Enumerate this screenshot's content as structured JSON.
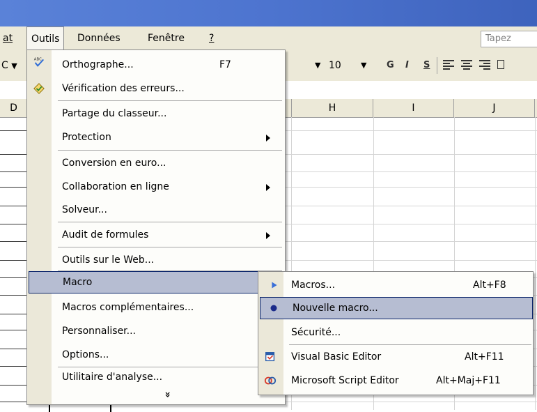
{
  "menubar": {
    "items": [
      "at",
      "Outils",
      "Données",
      "Fenêtre",
      "?"
    ],
    "ask_placeholder": "Tapez"
  },
  "toolbar": {
    "left_fragment": "C",
    "font_size": "10",
    "bold": "G",
    "italic": "I",
    "underline": "S"
  },
  "columns": [
    "D",
    "H",
    "I",
    "J"
  ],
  "tools_menu": {
    "items": [
      {
        "label": "Orthographe...",
        "shortcut": "F7",
        "icon": "spellcheck-icon"
      },
      {
        "label": "Vérification des erreurs...",
        "icon": "error-check-icon"
      },
      {
        "label": "Partage du classeur..."
      },
      {
        "label": "Protection",
        "submenu": true
      },
      {
        "label": "Conversion en euro..."
      },
      {
        "label": "Collaboration en ligne",
        "submenu": true
      },
      {
        "label": "Solveur..."
      },
      {
        "label": "Audit de formules",
        "submenu": true
      },
      {
        "label": "Outils sur le Web..."
      },
      {
        "label": "Macro",
        "submenu": true,
        "highlighted": true
      },
      {
        "label": "Macros complémentaires..."
      },
      {
        "label": "Personnaliser..."
      },
      {
        "label": "Options..."
      },
      {
        "label": "Utilitaire d'analyse..."
      }
    ],
    "expand_glyph": "»"
  },
  "macro_menu": {
    "items": [
      {
        "label": "Macros...",
        "shortcut": "Alt+F8",
        "icon": "run-macro-icon"
      },
      {
        "label": "Nouvelle macro...",
        "icon": "record-macro-icon",
        "highlighted": true
      },
      {
        "label": "Sécurité..."
      },
      {
        "label": "Visual Basic Editor",
        "shortcut": "Alt+F11",
        "icon": "vb-editor-icon"
      },
      {
        "label": "Microsoft Script Editor",
        "shortcut": "Alt+Maj+F11",
        "icon": "script-editor-icon"
      }
    ]
  },
  "colors": {
    "title_bar": "#4d74cf",
    "menu_highlight": "#b6bdd2",
    "menu_gutter": "#ebe8d9",
    "chrome": "#ece9d8"
  }
}
